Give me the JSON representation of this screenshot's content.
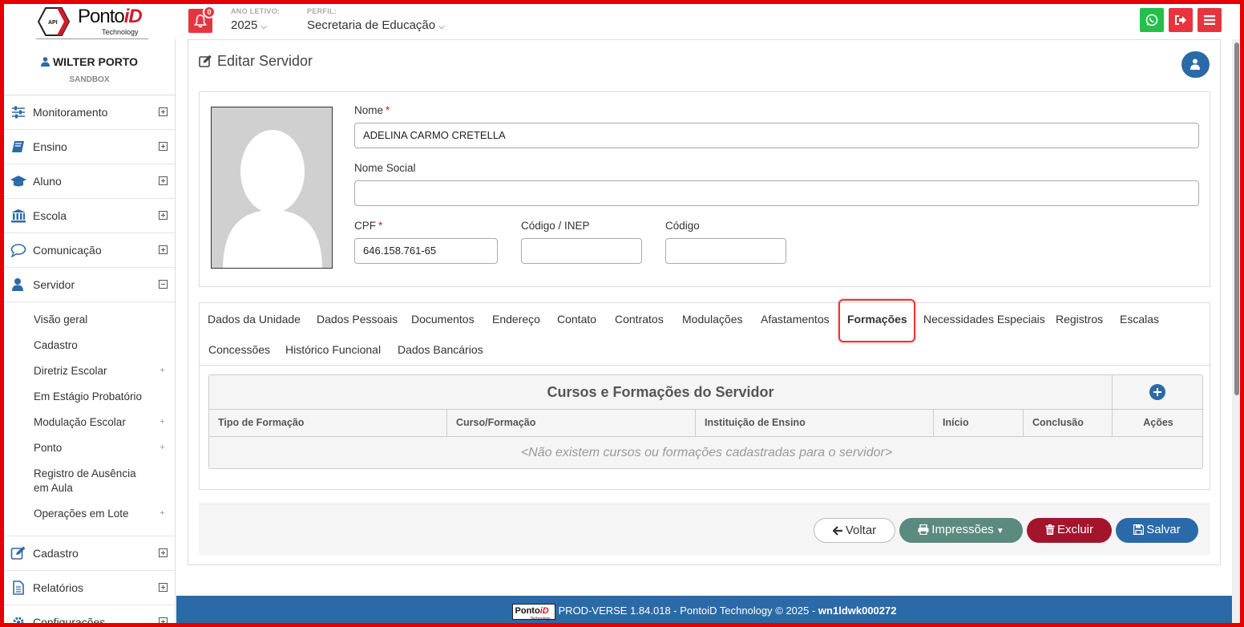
{
  "header": {
    "brand": "Ponto",
    "brand_accent": "iD",
    "brand_sub": "Technology",
    "logo_badge": "API",
    "notifications_count": "0",
    "ano_letivo_label": "ANO LETIVO:",
    "ano_letivo_value": "2025",
    "perfil_label": "PERFIL:",
    "perfil_value": "Secretaria de Educação"
  },
  "user": {
    "name": "WILTER PORTO",
    "env": "SANDBOX"
  },
  "sidebar": {
    "items": [
      {
        "label": "Monitoramento"
      },
      {
        "label": "Ensino"
      },
      {
        "label": "Aluno"
      },
      {
        "label": "Escola"
      },
      {
        "label": "Comunicação"
      },
      {
        "label": "Servidor"
      },
      {
        "label": "Cadastro"
      },
      {
        "label": "Relatórios"
      },
      {
        "label": "Configurações"
      }
    ],
    "servidor_sub": [
      {
        "label": "Visão geral"
      },
      {
        "label": "Cadastro"
      },
      {
        "label": "Diretriz Escolar"
      },
      {
        "label": "Em Estágio Probatório"
      },
      {
        "label": "Modulação Escolar"
      },
      {
        "label": "Ponto"
      },
      {
        "label": "Registro de Ausência em Aula"
      },
      {
        "label": "Operações em Lote"
      }
    ]
  },
  "page": {
    "title": "Editar Servidor"
  },
  "form": {
    "nome_label": "Nome",
    "nome_value": "ADELINA CARMO CRETELLA",
    "nome_social_label": "Nome Social",
    "nome_social_value": "",
    "cpf_label": "CPF",
    "cpf_value": "646.158.761-65",
    "inep_label": "Código / INEP",
    "inep_value": "",
    "codigo_label": "Código",
    "codigo_value": "",
    "required_mark": "*"
  },
  "tabs": [
    {
      "label": "Dados da Unidade"
    },
    {
      "label": "Dados Pessoais"
    },
    {
      "label": "Documentos"
    },
    {
      "label": "Endereço"
    },
    {
      "label": "Contato"
    },
    {
      "label": "Contratos"
    },
    {
      "label": "Modulações"
    },
    {
      "label": "Afastamentos"
    },
    {
      "label": "Formações"
    },
    {
      "label": "Necessidades Especiais"
    },
    {
      "label": "Registros"
    },
    {
      "label": "Escalas"
    },
    {
      "label": "Concessões"
    },
    {
      "label": "Histórico Funcional"
    },
    {
      "label": "Dados Bancários"
    }
  ],
  "active_tab": "Formações",
  "grid": {
    "title": "Cursos e Formações do Servidor",
    "columns": [
      "Tipo de Formação",
      "Curso/Formação",
      "Instituição de Ensino",
      "Início",
      "Conclusão",
      "Ações"
    ],
    "empty_message": "<Não existem cursos ou formações cadastradas para o servidor>"
  },
  "actions": {
    "voltar": "Voltar",
    "impressoes": "Impressões",
    "excluir": "Excluir",
    "salvar": "Salvar"
  },
  "footer": {
    "text": "PROD-VERSE 1.84.018 - PontoiD Technology © 2025 - ",
    "host": "wn1ldwk000272",
    "logo_text": "Ponto",
    "logo_accent": "iD",
    "logo_sub": "Technology"
  },
  "colors": {
    "primary": "#2b6aa8",
    "danger": "#e8343f",
    "whatsapp": "#25c04a",
    "teal": "#5b8a7f",
    "excluir": "#a3142d"
  }
}
